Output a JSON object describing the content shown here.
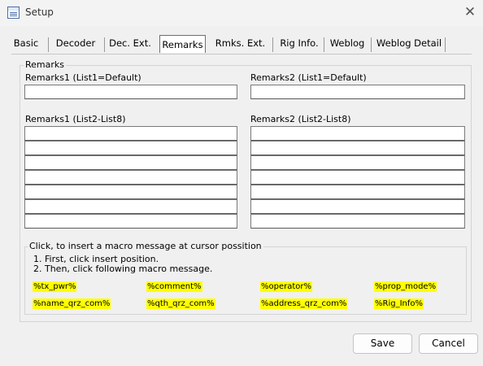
{
  "window": {
    "title": "Setup"
  },
  "tabs": [
    {
      "label": "Basic"
    },
    {
      "label": "Decoder"
    },
    {
      "label": "Dec. Ext."
    },
    {
      "label": "Remarks",
      "active": true
    },
    {
      "label": "Rmks. Ext."
    },
    {
      "label": "Rig Info."
    },
    {
      "label": "Weblog"
    },
    {
      "label": "Weblog Detail"
    }
  ],
  "remarks": {
    "group_title": "Remarks",
    "r1_default_label": "Remarks1 (List1=Default)",
    "r2_default_label": "Remarks2 (List1=Default)",
    "r1_list_label": "Remarks1 (List2-List8)",
    "r2_list_label": "Remarks2 (List2-List8)",
    "r1_default_value": "",
    "r2_default_value": "",
    "r1_list": [
      "",
      "",
      "",
      "",
      "",
      "",
      ""
    ],
    "r2_list": [
      "",
      "",
      "",
      "",
      "",
      "",
      ""
    ]
  },
  "macro": {
    "title": "Click, to insert a macro message at cursor possition",
    "step1": "1. First, click insert position.",
    "step2": "2. Then, click following macro message.",
    "items": [
      "%tx_pwr%",
      "%comment%",
      "%operator%",
      "%prop_mode%",
      "%name_qrz_com%",
      "%qth_qrz_com%",
      "%address_qrz_com%",
      "%Rig_Info%"
    ],
    "highlight_color": "#ffff00"
  },
  "buttons": {
    "save": "Save",
    "cancel": "Cancel"
  }
}
